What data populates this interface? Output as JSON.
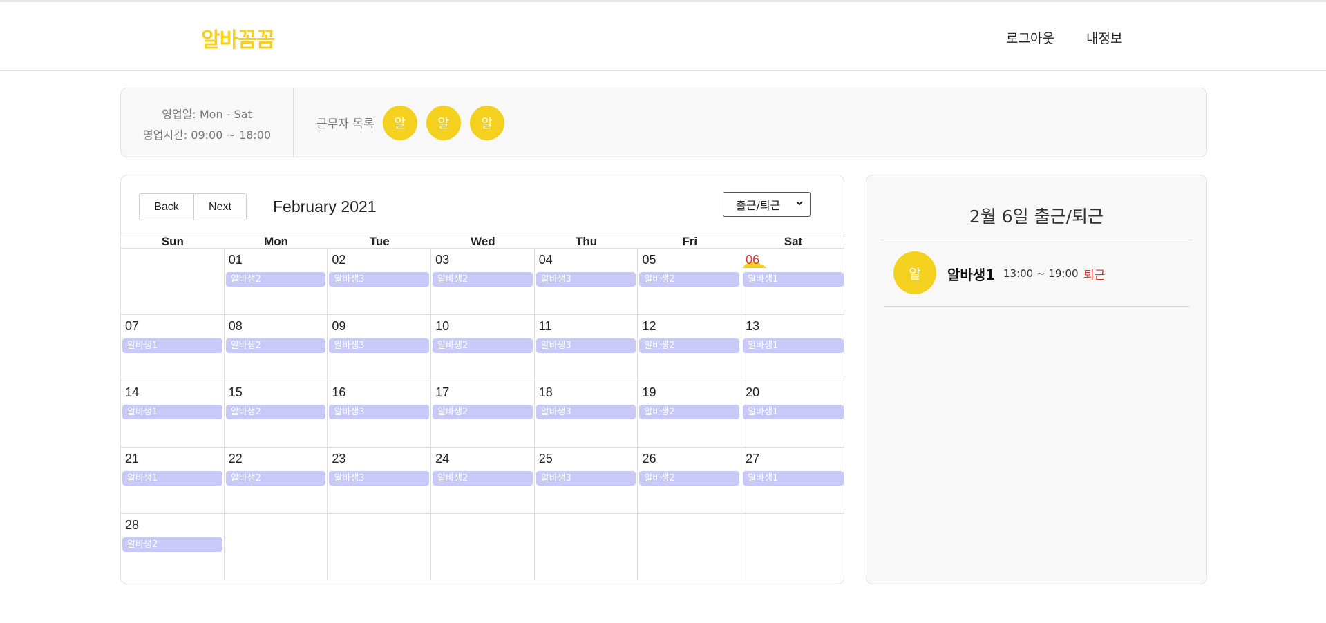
{
  "header": {
    "logo": "알바꼼꼼",
    "logout": "로그아웃",
    "myinfo": "내정보"
  },
  "infobar": {
    "business_days": "영업일: Mon - Sat",
    "business_hours": "영업시간: 09:00 ~ 18:00",
    "workers_label": "근무자 목록",
    "workers": [
      "알",
      "알",
      "알"
    ]
  },
  "calendar": {
    "back_label": "Back",
    "next_label": "Next",
    "title": "February 2021",
    "mode_select": "출근/퇴근",
    "weekdays": [
      "Sun",
      "Mon",
      "Tue",
      "Wed",
      "Thu",
      "Fri",
      "Sat"
    ],
    "weeks": [
      [
        {
          "day": "",
          "event": ""
        },
        {
          "day": "01",
          "event": "알바생2"
        },
        {
          "day": "02",
          "event": "알바생3"
        },
        {
          "day": "03",
          "event": "알바생2"
        },
        {
          "day": "04",
          "event": "알바생3"
        },
        {
          "day": "05",
          "event": "알바생2"
        },
        {
          "day": "06",
          "event": "알바생1",
          "today": true
        }
      ],
      [
        {
          "day": "07",
          "event": "알바생1"
        },
        {
          "day": "08",
          "event": "알바생2"
        },
        {
          "day": "09",
          "event": "알바생3"
        },
        {
          "day": "10",
          "event": "알바생2"
        },
        {
          "day": "11",
          "event": "알바생3"
        },
        {
          "day": "12",
          "event": "알바생2"
        },
        {
          "day": "13",
          "event": "알바생1"
        }
      ],
      [
        {
          "day": "14",
          "event": "알바생1"
        },
        {
          "day": "15",
          "event": "알바생2"
        },
        {
          "day": "16",
          "event": "알바생3"
        },
        {
          "day": "17",
          "event": "알바생2"
        },
        {
          "day": "18",
          "event": "알바생3"
        },
        {
          "day": "19",
          "event": "알바생2"
        },
        {
          "day": "20",
          "event": "알바생1"
        }
      ],
      [
        {
          "day": "21",
          "event": "알바생1"
        },
        {
          "day": "22",
          "event": "알바생2"
        },
        {
          "day": "23",
          "event": "알바생3"
        },
        {
          "day": "24",
          "event": "알바생2"
        },
        {
          "day": "25",
          "event": "알바생3"
        },
        {
          "day": "26",
          "event": "알바생2"
        },
        {
          "day": "27",
          "event": "알바생1"
        }
      ],
      [
        {
          "day": "28",
          "event": "알바생2"
        },
        {
          "day": "",
          "event": ""
        },
        {
          "day": "",
          "event": ""
        },
        {
          "day": "",
          "event": ""
        },
        {
          "day": "",
          "event": ""
        },
        {
          "day": "",
          "event": ""
        },
        {
          "day": "",
          "event": ""
        }
      ]
    ]
  },
  "side": {
    "title": "2월 6일 출근/퇴근",
    "records": [
      {
        "avatar": "알",
        "name": "알바생1",
        "time": "13:00 ~ 19:00",
        "status": "퇴근"
      }
    ]
  },
  "colors": {
    "accent": "#f5d11f",
    "event_bg": "#c8c9f9",
    "status_red": "#e03030"
  }
}
